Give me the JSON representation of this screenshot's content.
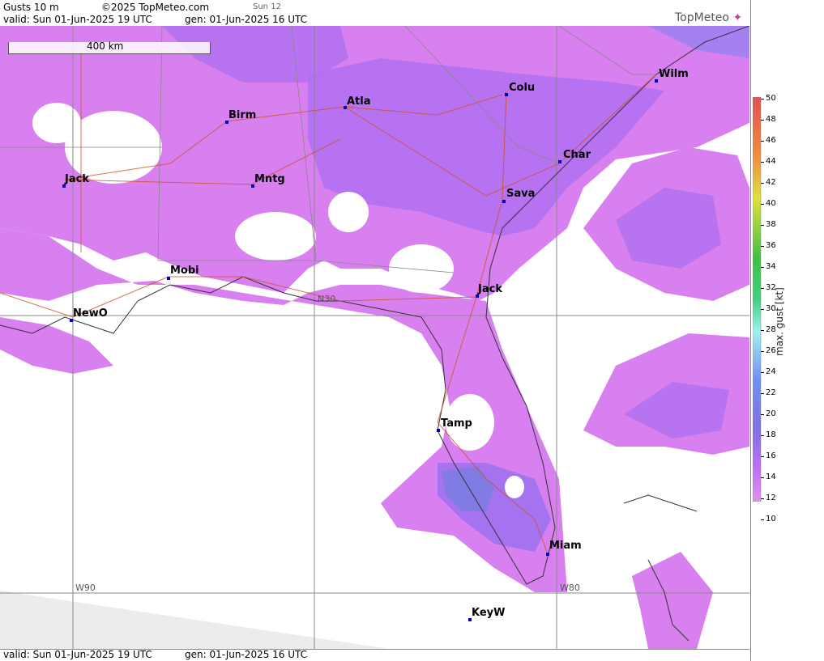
{
  "header": {
    "product": "Gusts 10 m",
    "copyright": "©2025 TopMeteo.com",
    "day": "Sun 12",
    "valid": "valid:  Sun  01-Jun-2025  19 UTC",
    "gen": "gen: 01-Jun-2025 16 UTC"
  },
  "footer": {
    "valid": "valid:  Sun  01-Jun-2025  19 UTC",
    "gen": "gen: 01-Jun-2025 16 UTC"
  },
  "logo": "TopMeteo",
  "scale_bar": "400 km",
  "grid_labels": {
    "w90": "W90",
    "w80": "W80",
    "n30": "N30"
  },
  "cities": [
    {
      "id": "jack-ms",
      "name": "Jack"
    },
    {
      "id": "birm",
      "name": "Birm"
    },
    {
      "id": "atla",
      "name": "Atla"
    },
    {
      "id": "colu",
      "name": "Colu"
    },
    {
      "id": "wilm",
      "name": "Wilm"
    },
    {
      "id": "mntg",
      "name": "Mntg"
    },
    {
      "id": "char",
      "name": "Char"
    },
    {
      "id": "sava",
      "name": "Sava"
    },
    {
      "id": "mobi",
      "name": "Mobi"
    },
    {
      "id": "jack-fl",
      "name": "Jack"
    },
    {
      "id": "newo",
      "name": "NewO"
    },
    {
      "id": "tamp",
      "name": "Tamp"
    },
    {
      "id": "miam",
      "name": "Miam"
    },
    {
      "id": "keyw",
      "name": "KeyW"
    }
  ],
  "legend": {
    "label": "max. gust [kt]",
    "ticks": [
      "50",
      "48",
      "46",
      "44",
      "42",
      "40",
      "38",
      "36",
      "34",
      "32",
      "30",
      "28",
      "26",
      "24",
      "22",
      "20",
      "18",
      "16",
      "14",
      "12",
      "10"
    ],
    "colors": {
      "low": "#d880f0",
      "mid": "#a070f0",
      "high": "#7070e0",
      "cyan": "#a0f0f0",
      "green": "#40c040",
      "yellow": "#e0e040",
      "red": "#e05050"
    }
  }
}
